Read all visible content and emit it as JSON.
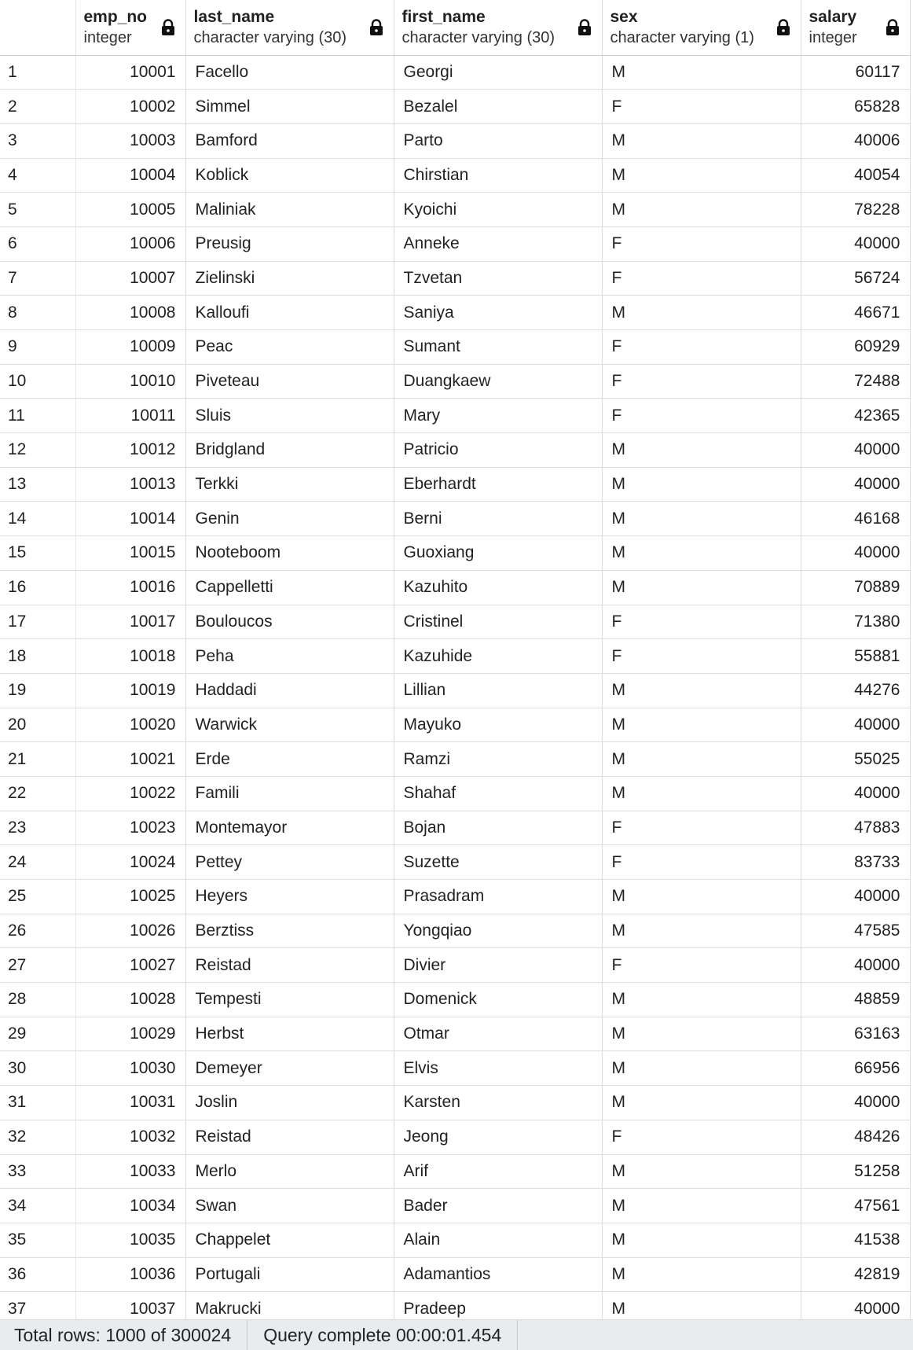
{
  "columns": [
    {
      "name": "emp_no",
      "type": "integer"
    },
    {
      "name": "last_name",
      "type": "character varying (30)"
    },
    {
      "name": "first_name",
      "type": "character varying (30)"
    },
    {
      "name": "sex",
      "type": "character varying (1)"
    },
    {
      "name": "salary",
      "type": "integer"
    }
  ],
  "rows": [
    {
      "idx": "1",
      "emp_no": "10001",
      "last_name": "Facello",
      "first_name": "Georgi",
      "sex": "M",
      "salary": "60117"
    },
    {
      "idx": "2",
      "emp_no": "10002",
      "last_name": "Simmel",
      "first_name": "Bezalel",
      "sex": "F",
      "salary": "65828"
    },
    {
      "idx": "3",
      "emp_no": "10003",
      "last_name": "Bamford",
      "first_name": "Parto",
      "sex": "M",
      "salary": "40006"
    },
    {
      "idx": "4",
      "emp_no": "10004",
      "last_name": "Koblick",
      "first_name": "Chirstian",
      "sex": "M",
      "salary": "40054"
    },
    {
      "idx": "5",
      "emp_no": "10005",
      "last_name": "Maliniak",
      "first_name": "Kyoichi",
      "sex": "M",
      "salary": "78228"
    },
    {
      "idx": "6",
      "emp_no": "10006",
      "last_name": "Preusig",
      "first_name": "Anneke",
      "sex": "F",
      "salary": "40000"
    },
    {
      "idx": "7",
      "emp_no": "10007",
      "last_name": "Zielinski",
      "first_name": "Tzvetan",
      "sex": "F",
      "salary": "56724"
    },
    {
      "idx": "8",
      "emp_no": "10008",
      "last_name": "Kalloufi",
      "first_name": "Saniya",
      "sex": "M",
      "salary": "46671"
    },
    {
      "idx": "9",
      "emp_no": "10009",
      "last_name": "Peac",
      "first_name": "Sumant",
      "sex": "F",
      "salary": "60929"
    },
    {
      "idx": "10",
      "emp_no": "10010",
      "last_name": "Piveteau",
      "first_name": "Duangkaew",
      "sex": "F",
      "salary": "72488"
    },
    {
      "idx": "11",
      "emp_no": "10011",
      "last_name": "Sluis",
      "first_name": "Mary",
      "sex": "F",
      "salary": "42365"
    },
    {
      "idx": "12",
      "emp_no": "10012",
      "last_name": "Bridgland",
      "first_name": "Patricio",
      "sex": "M",
      "salary": "40000"
    },
    {
      "idx": "13",
      "emp_no": "10013",
      "last_name": "Terkki",
      "first_name": "Eberhardt",
      "sex": "M",
      "salary": "40000"
    },
    {
      "idx": "14",
      "emp_no": "10014",
      "last_name": "Genin",
      "first_name": "Berni",
      "sex": "M",
      "salary": "46168"
    },
    {
      "idx": "15",
      "emp_no": "10015",
      "last_name": "Nooteboom",
      "first_name": "Guoxiang",
      "sex": "M",
      "salary": "40000"
    },
    {
      "idx": "16",
      "emp_no": "10016",
      "last_name": "Cappelletti",
      "first_name": "Kazuhito",
      "sex": "M",
      "salary": "70889"
    },
    {
      "idx": "17",
      "emp_no": "10017",
      "last_name": "Bouloucos",
      "first_name": "Cristinel",
      "sex": "F",
      "salary": "71380"
    },
    {
      "idx": "18",
      "emp_no": "10018",
      "last_name": "Peha",
      "first_name": "Kazuhide",
      "sex": "F",
      "salary": "55881"
    },
    {
      "idx": "19",
      "emp_no": "10019",
      "last_name": "Haddadi",
      "first_name": "Lillian",
      "sex": "M",
      "salary": "44276"
    },
    {
      "idx": "20",
      "emp_no": "10020",
      "last_name": "Warwick",
      "first_name": "Mayuko",
      "sex": "M",
      "salary": "40000"
    },
    {
      "idx": "21",
      "emp_no": "10021",
      "last_name": "Erde",
      "first_name": "Ramzi",
      "sex": "M",
      "salary": "55025"
    },
    {
      "idx": "22",
      "emp_no": "10022",
      "last_name": "Famili",
      "first_name": "Shahaf",
      "sex": "M",
      "salary": "40000"
    },
    {
      "idx": "23",
      "emp_no": "10023",
      "last_name": "Montemayor",
      "first_name": "Bojan",
      "sex": "F",
      "salary": "47883"
    },
    {
      "idx": "24",
      "emp_no": "10024",
      "last_name": "Pettey",
      "first_name": "Suzette",
      "sex": "F",
      "salary": "83733"
    },
    {
      "idx": "25",
      "emp_no": "10025",
      "last_name": "Heyers",
      "first_name": "Prasadram",
      "sex": "M",
      "salary": "40000"
    },
    {
      "idx": "26",
      "emp_no": "10026",
      "last_name": "Berztiss",
      "first_name": "Yongqiao",
      "sex": "M",
      "salary": "47585"
    },
    {
      "idx": "27",
      "emp_no": "10027",
      "last_name": "Reistad",
      "first_name": "Divier",
      "sex": "F",
      "salary": "40000"
    },
    {
      "idx": "28",
      "emp_no": "10028",
      "last_name": "Tempesti",
      "first_name": "Domenick",
      "sex": "M",
      "salary": "48859"
    },
    {
      "idx": "29",
      "emp_no": "10029",
      "last_name": "Herbst",
      "first_name": "Otmar",
      "sex": "M",
      "salary": "63163"
    },
    {
      "idx": "30",
      "emp_no": "10030",
      "last_name": "Demeyer",
      "first_name": "Elvis",
      "sex": "M",
      "salary": "66956"
    },
    {
      "idx": "31",
      "emp_no": "10031",
      "last_name": "Joslin",
      "first_name": "Karsten",
      "sex": "M",
      "salary": "40000"
    },
    {
      "idx": "32",
      "emp_no": "10032",
      "last_name": "Reistad",
      "first_name": "Jeong",
      "sex": "F",
      "salary": "48426"
    },
    {
      "idx": "33",
      "emp_no": "10033",
      "last_name": "Merlo",
      "first_name": "Arif",
      "sex": "M",
      "salary": "51258"
    },
    {
      "idx": "34",
      "emp_no": "10034",
      "last_name": "Swan",
      "first_name": "Bader",
      "sex": "M",
      "salary": "47561"
    },
    {
      "idx": "35",
      "emp_no": "10035",
      "last_name": "Chappelet",
      "first_name": "Alain",
      "sex": "M",
      "salary": "41538"
    },
    {
      "idx": "36",
      "emp_no": "10036",
      "last_name": "Portugali",
      "first_name": "Adamantios",
      "sex": "M",
      "salary": "42819"
    },
    {
      "idx": "37",
      "emp_no": "10037",
      "last_name": "Makrucki",
      "first_name": "Pradeep",
      "sex": "M",
      "salary": "40000"
    }
  ],
  "status": {
    "total_rows": "Total rows: 1000 of 300024",
    "query_complete": "Query complete 00:00:01.454"
  },
  "icons": {
    "column_lock": "lock-icon"
  },
  "colors": {
    "status_bar_bg": "#e9ecef",
    "grid_border": "#dcdcdc"
  }
}
